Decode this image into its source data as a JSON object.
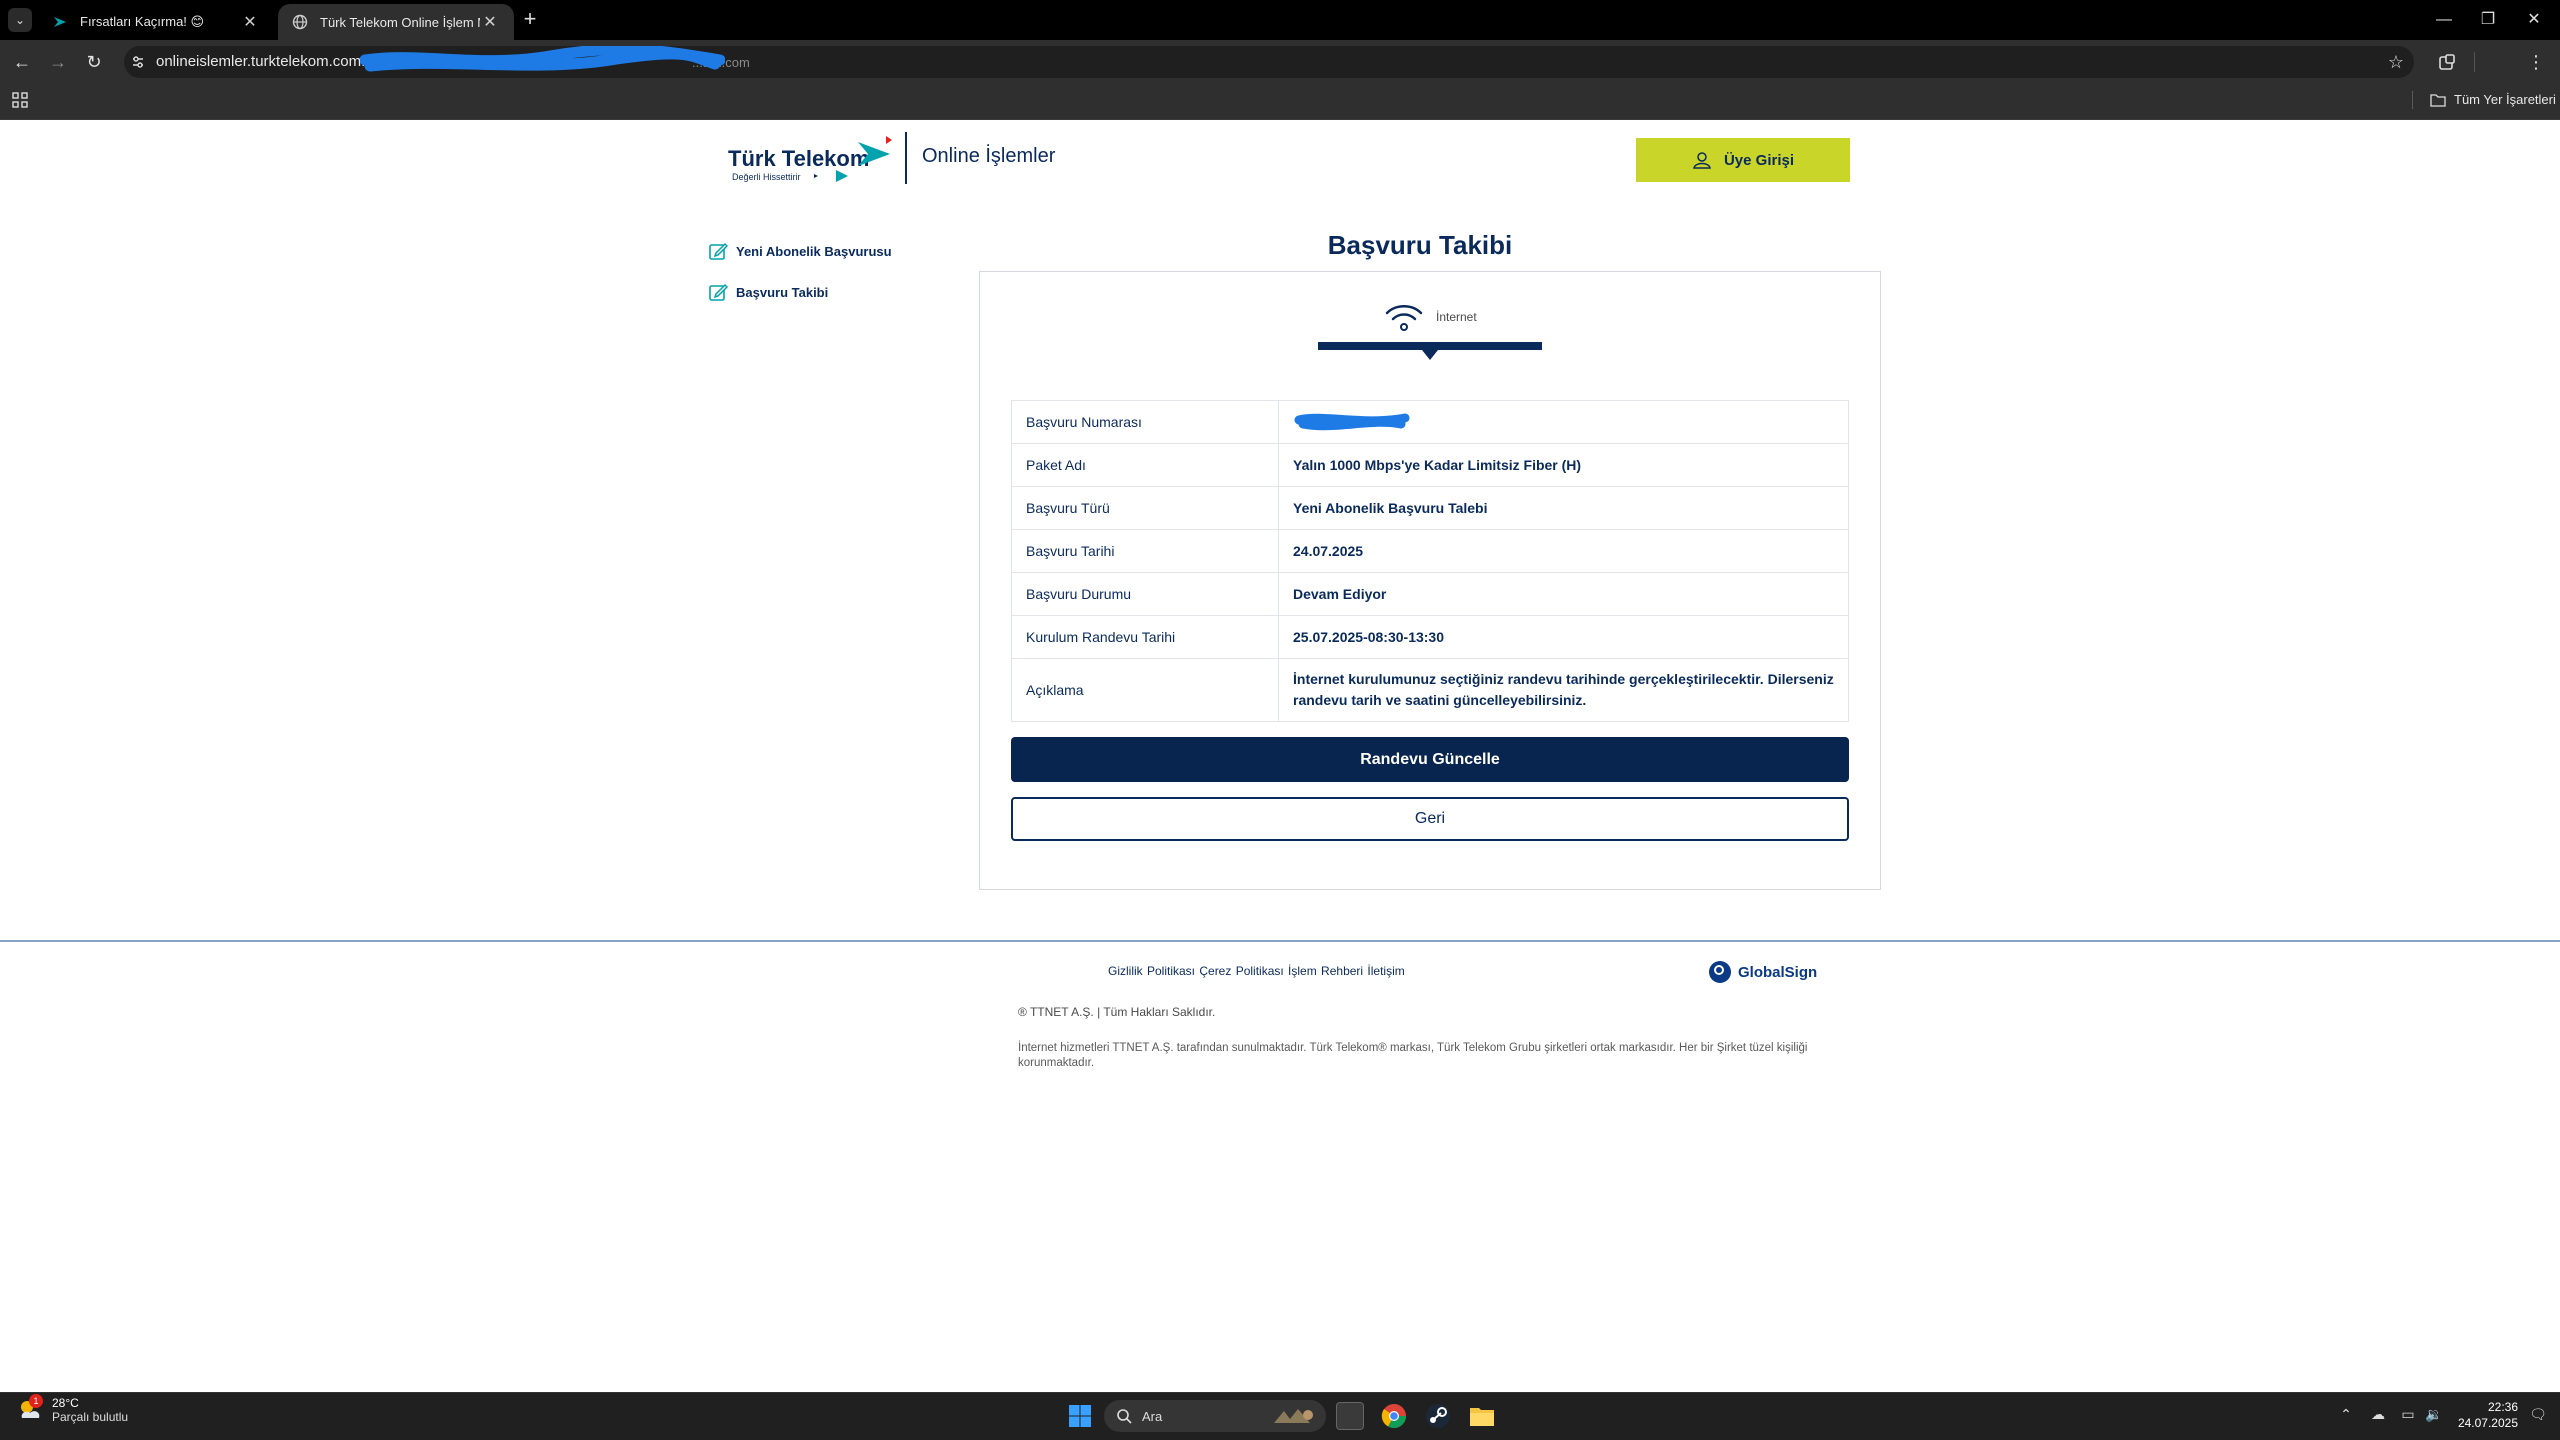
{
  "browser": {
    "tabs": [
      {
        "title": "Fırsatları Kaçırma! 😊",
        "active": false
      },
      {
        "title": "Türk Telekom Online İşlem Mer",
        "active": true
      }
    ],
    "url_visible": "onlineislemler.turktelekom.com.tr",
    "url_tail": "...ard.com",
    "bookmarks_label": "Tüm Yer İşaretleri"
  },
  "header": {
    "brand": "Türk Telekom",
    "slogan": "Değerli Hissettirir",
    "sub_brand": "Online İşlemler",
    "login_label": "Üye Girişi"
  },
  "sidebar": {
    "items": [
      {
        "label": "Yeni Abonelik Başvurusu"
      },
      {
        "label": "Başvuru Takibi"
      }
    ]
  },
  "main": {
    "title": "Başvuru Takibi",
    "service_tab": "İnternet",
    "rows": [
      {
        "key": "Başvuru Numarası",
        "value": ""
      },
      {
        "key": "Paket Adı",
        "value": "Yalın 1000 Mbps'ye Kadar Limitsiz Fiber (H)"
      },
      {
        "key": "Başvuru Türü",
        "value": "Yeni Abonelik Başvuru Talebi"
      },
      {
        "key": "Başvuru Tarihi",
        "value": "24.07.2025"
      },
      {
        "key": "Başvuru Durumu",
        "value": "Devam Ediyor"
      },
      {
        "key": "Kurulum Randevu Tarihi",
        "value": "25.07.2025-08:30-13:30"
      },
      {
        "key": "Açıklama",
        "value": "İnternet kurulumunuz seçtiğiniz randevu tarihinde gerçekleştirilecektir. Dilerseniz randevu tarih ve saatini güncelleyebilirsiniz."
      }
    ],
    "update_button": "Randevu Güncelle",
    "back_button": "Geri"
  },
  "footer": {
    "links": "Gizlilik Politikası Çerez Politikası İşlem Rehberi İletişim",
    "globalsign": "GlobalSign",
    "copyright": "® TTNET A.Ş. | Tüm Hakları Saklıdır.",
    "disclaimer": "İnternet hizmetleri TTNET A.Ş. tarafından sunulmaktadır. Türk Telekom® markası, Türk Telekom Grubu şirketleri ortak markasıdır. Her bir Şirket tüzel kişiliği korunmaktadır."
  },
  "taskbar": {
    "temperature": "28°C",
    "weather": "Parçalı bulutlu",
    "weather_badge": "1",
    "search_label": "Ara",
    "time": "22:36",
    "date": "24.07.2025"
  },
  "colors": {
    "navy": "#0a2a5c",
    "button_navy": "#07254f",
    "login_yellow": "#c9d629",
    "teal": "#00a3ad",
    "redaction_blue": "#1e7be6"
  }
}
